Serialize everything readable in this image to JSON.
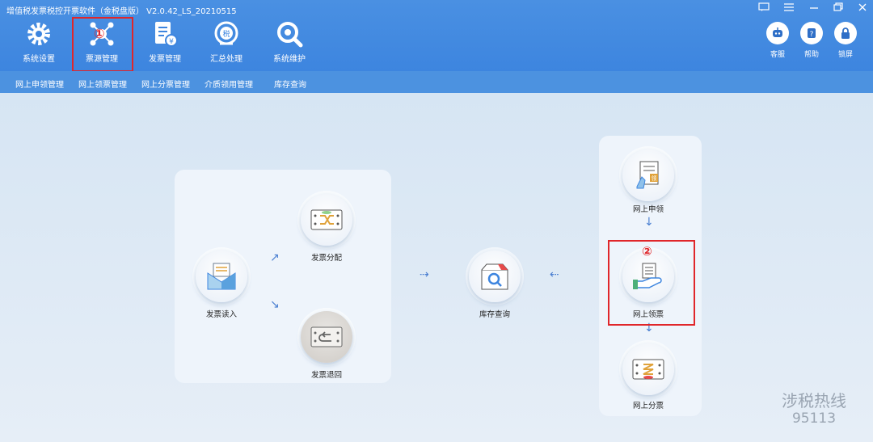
{
  "window": {
    "title": "增值税发票税控开票软件（金税盘版） V2.0.42_LS_20210515",
    "controls": [
      "feedback-icon",
      "menu-icon",
      "minimize-icon",
      "restore-icon",
      "close-icon"
    ]
  },
  "toolbar": {
    "items": [
      {
        "label": "系统设置",
        "icon": "gear-icon"
      },
      {
        "label": "票源管理",
        "icon": "network-icon"
      },
      {
        "label": "发票管理",
        "icon": "invoice-icon"
      },
      {
        "label": "汇总处理",
        "icon": "tax-icon"
      },
      {
        "label": "系统维护",
        "icon": "wrench-icon"
      }
    ],
    "right": [
      {
        "label": "客服",
        "icon": "robot-icon"
      },
      {
        "label": "帮助",
        "icon": "help-icon"
      },
      {
        "label": "锁屏",
        "icon": "lock-icon"
      }
    ]
  },
  "subnav": [
    "网上申领管理",
    "网上领票管理",
    "网上分票管理",
    "介质领用管理",
    "库存查询"
  ],
  "flow": {
    "read": "发票读入",
    "distribute": "发票分配",
    "return": "发票退回",
    "inventory": "库存查询",
    "apply": "网上申领",
    "receive": "网上领票",
    "split": "网上分票"
  },
  "annotations": {
    "marker1": "①",
    "marker2": "②",
    "highlight_color": "#e0262a"
  },
  "watermark": {
    "line1": "涉税热线",
    "line2": "95113"
  },
  "colors": {
    "header": "#4a90e2",
    "accent": "#3d85df"
  }
}
